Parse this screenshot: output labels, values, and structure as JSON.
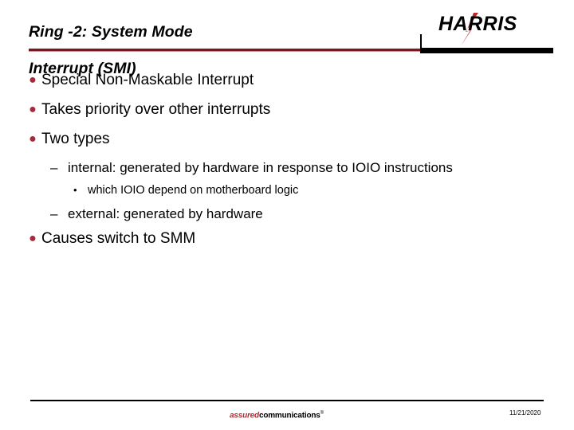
{
  "slide": {
    "title": "Ring -2: System Mode\nInterrupt (SMI)",
    "title_line1": "Ring -2: System Mode",
    "title_line2": "Interrupt (SMI)",
    "logo": {
      "brand": "HARRIS",
      "accent_color": "#C0272D",
      "text_color": "#000000"
    },
    "accents": {
      "title_rule_color": "#7B1520",
      "bullet_color": "#A52A3A",
      "black_bar_color": "#000000"
    },
    "bullets": [
      {
        "level": 1,
        "marker": "●",
        "text": "Special Non-Maskable Interrupt"
      },
      {
        "level": 1,
        "marker": "●",
        "text": "Takes priority over other interrupts"
      },
      {
        "level": 1,
        "marker": "●",
        "text": "Two types"
      },
      {
        "level": 2,
        "marker": "–",
        "text": "internal: generated by hardware in response to IOIO instructions"
      },
      {
        "level": 3,
        "marker": "•",
        "text": "which IOIO depend on motherboard logic"
      },
      {
        "level": 2,
        "marker": "–",
        "text": "external: generated by hardware"
      },
      {
        "level": 1,
        "marker": "●",
        "text": "Causes switch to SMM"
      }
    ],
    "footer": {
      "tagline_primary": "assured",
      "tagline_secondary": "communications",
      "tagline_mark": "®",
      "date": "11/21/2020"
    }
  }
}
